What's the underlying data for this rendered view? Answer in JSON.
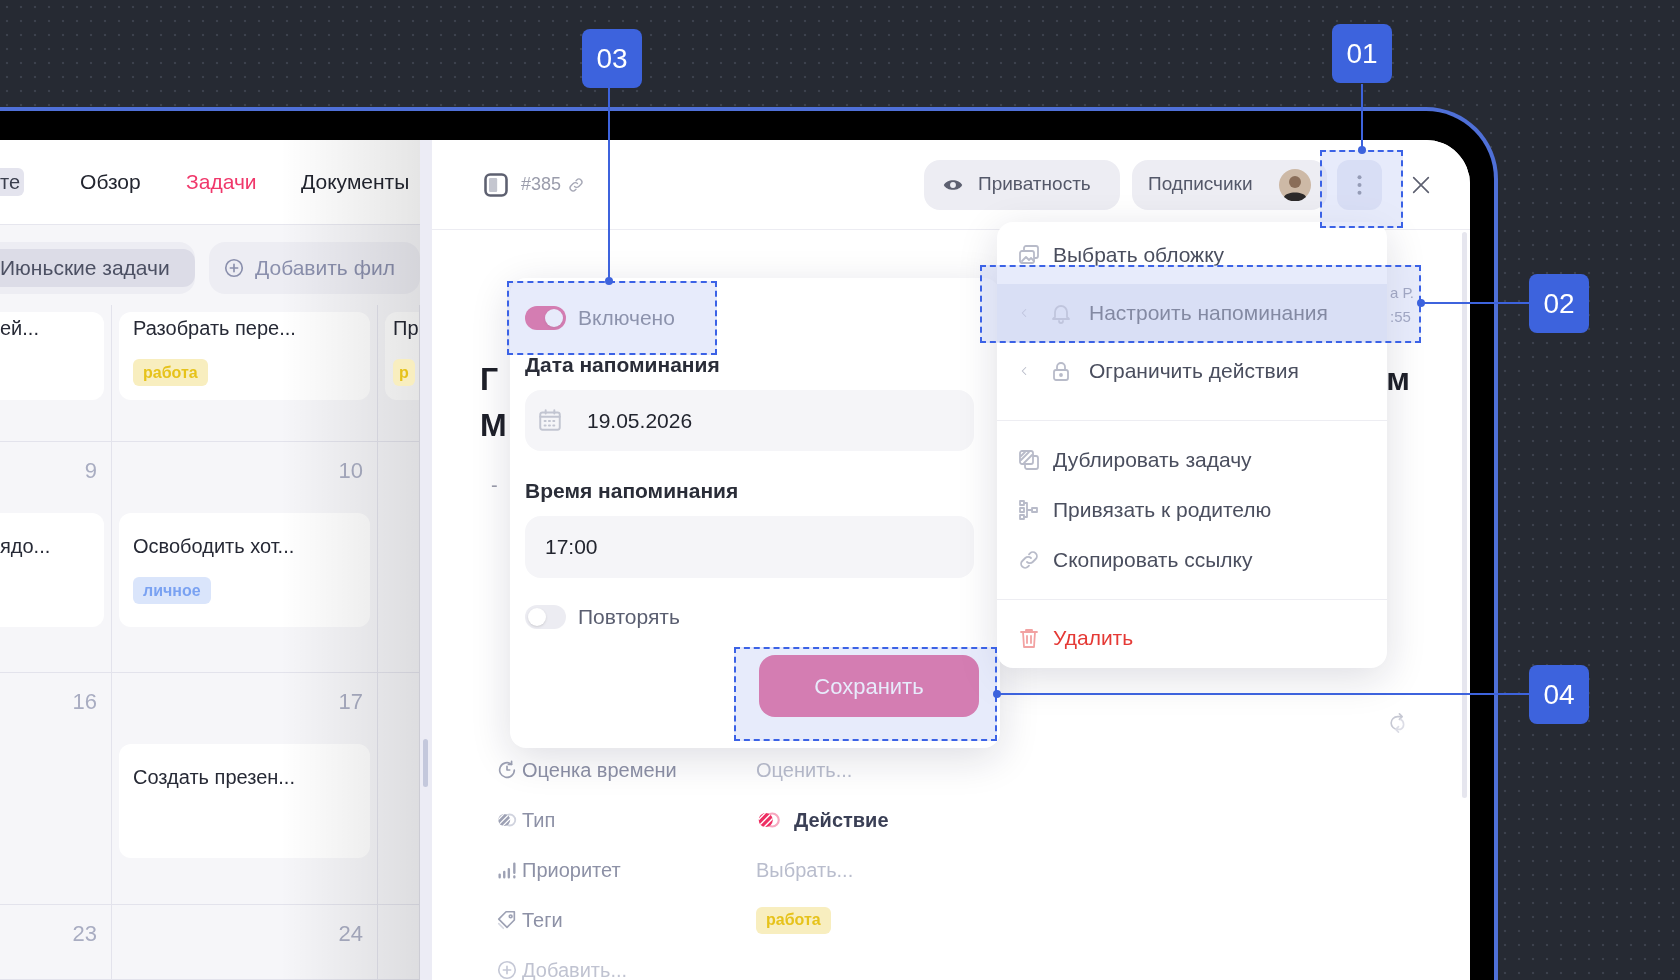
{
  "annotations": [
    {
      "label": "01"
    },
    {
      "label": "02"
    },
    {
      "label": "03"
    },
    {
      "label": "04"
    }
  ],
  "left_panel": {
    "workspace_chip": "те",
    "tabs": [
      {
        "label": "Обзор",
        "selected": false
      },
      {
        "label": "Задачи",
        "selected": true
      },
      {
        "label": "Документы",
        "selected": false
      }
    ],
    "filters": [
      {
        "label": "Июньские задачи",
        "kind": "view"
      },
      {
        "label": "Добавить фил",
        "kind": "add"
      }
    ],
    "calendar": {
      "weeks": [
        {
          "days": [
            {
              "tasks": [
                {
                  "title": "ей..."
                }
              ]
            },
            {
              "tasks": [
                {
                  "title": "Разобрать пере...",
                  "tag": {
                    "label": "работа",
                    "color": "#e6c21a"
                  }
                }
              ]
            },
            {
              "tasks": [
                {
                  "title": "Пр",
                  "tag": {
                    "label": "р",
                    "color": "#e6c21a"
                  }
                }
              ]
            }
          ]
        },
        {
          "days": [
            {
              "number": "9",
              "tasks": [
                {
                  "title": "ядо..."
                }
              ]
            },
            {
              "number": "10",
              "tasks": [
                {
                  "title": "Освободить хот...",
                  "tag": {
                    "label": "личное",
                    "color": "#7aa2f2"
                  }
                }
              ]
            }
          ]
        },
        {
          "days": [
            {
              "number": "16"
            },
            {
              "number": "17",
              "tasks": [
                {
                  "title": "Создать презен..."
                }
              ]
            }
          ]
        },
        {
          "days": [
            {
              "number": "23"
            },
            {
              "number": "24"
            }
          ]
        }
      ]
    }
  },
  "task_panel": {
    "number": "#385",
    "header_buttons": [
      {
        "label": "Приватность",
        "kind": "privacy"
      },
      {
        "label": "Подписчики",
        "kind": "subscribers"
      }
    ],
    "title_line_1": {
      "start": "Г",
      "end": "м"
    },
    "title_line_2": "М",
    "subtitle": "-",
    "obscured_texts": [
      "а Р.",
      ":55"
    ],
    "properties": [
      {
        "label": "Оценка времени",
        "value": "Оценить...",
        "kind": "estimate"
      },
      {
        "label": "Тип",
        "value": "Действие",
        "kind": "type"
      },
      {
        "label": "Приоритет",
        "value": "Выбрать...",
        "kind": "priority"
      },
      {
        "label": "Теги",
        "value": "работа",
        "kind": "tags",
        "color": "#e6c21a"
      },
      {
        "label": "Добавить...",
        "kind": "add"
      }
    ]
  },
  "reminder_popup": {
    "enabled": {
      "label": "Включено",
      "on": true
    },
    "date_label": "Дата напоминания",
    "date_value": "19.05.2026",
    "time_label": "Время напоминания",
    "time_value": "17:00",
    "repeat": {
      "label": "Повторять",
      "on": false
    },
    "save_button": "Сохранить"
  },
  "menu": {
    "groups": [
      {
        "items": [
          {
            "label": "Выбрать обложку",
            "kind": "cover",
            "submenu": false,
            "selected": false
          },
          {
            "label": "Настроить напоминания",
            "kind": "reminder",
            "submenu": true,
            "selected": true
          },
          {
            "label": "Ограничить действия",
            "kind": "restrict",
            "submenu": true,
            "selected": false
          }
        ]
      },
      {
        "items": [
          {
            "label": "Дублировать задачу",
            "kind": "duplicate",
            "submenu": false,
            "selected": false
          },
          {
            "label": "Привязать к родителю",
            "kind": "parent",
            "submenu": false,
            "selected": false
          },
          {
            "label": "Скопировать ссылку",
            "kind": "link",
            "submenu": false,
            "selected": false
          }
        ]
      },
      {
        "items": [
          {
            "label": "Удалить",
            "kind": "delete",
            "submenu": false,
            "selected": false
          }
        ]
      }
    ]
  }
}
